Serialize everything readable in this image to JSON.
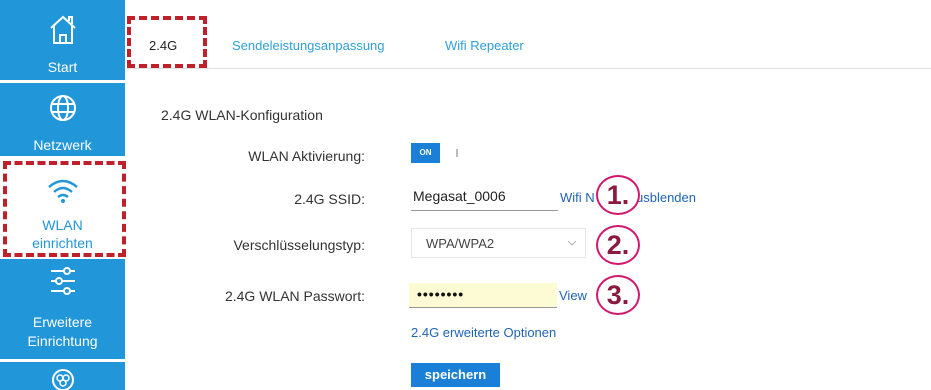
{
  "sidebar": {
    "items": [
      {
        "label": "Start"
      },
      {
        "label": "Netzwerk"
      },
      {
        "label_line1": "WLAN",
        "label_line2": "einrichten"
      },
      {
        "label_line1": "Erweitere",
        "label_line2": "Einrichtung"
      },
      {
        "label": ""
      }
    ]
  },
  "tabs": [
    {
      "label": "2.4G"
    },
    {
      "label": "Sendeleistungsanpassung"
    },
    {
      "label": "Wifi Repeater"
    }
  ],
  "form": {
    "section_title": "2.4G WLAN-Konfiguration",
    "wlan_activation_label": "WLAN Aktivierung:",
    "toggle_on": "ON",
    "ssid_label": "2.4G SSID:",
    "ssid_value": "Megasat_0006",
    "hide_link": "Wifi N",
    "hide_link_end": "usblenden",
    "encryption_label": "Verschlüsselungstyp:",
    "encryption_value": "WPA/WPA2",
    "password_label": "2.4G WLAN Passwort:",
    "password_mask": "••••••••",
    "view_link": "View",
    "advanced_link": "2.4G erweiterte Optionen",
    "save_button": "speichern"
  },
  "annotations": {
    "step1": "1.",
    "step2": "2.",
    "step3": "3."
  },
  "colors": {
    "sidebar": "#2196d9",
    "accent": "#1a7fd6",
    "highlight_dash": "#c0202a",
    "badge_border": "#d1186d"
  }
}
